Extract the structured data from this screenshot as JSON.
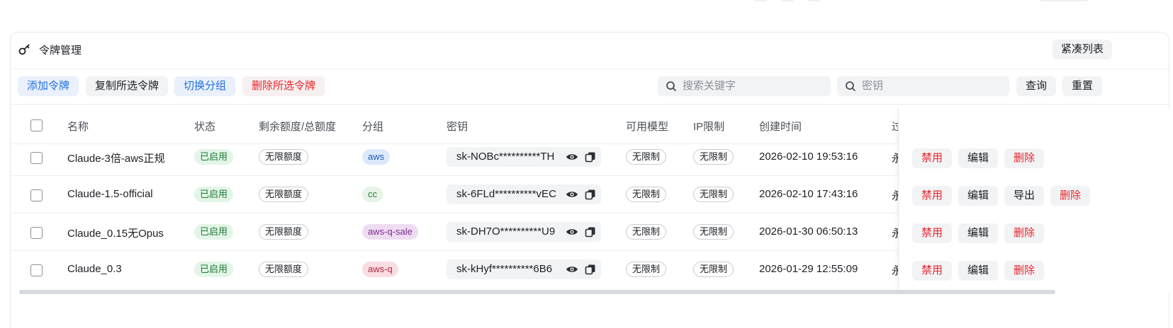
{
  "title": "令牌管理",
  "compact_label": "紧凑列表",
  "toolbar": {
    "add": "添加令牌",
    "copy_selected": "复制所选令牌",
    "switch_group": "切换分组",
    "delete_selected": "删除所选令牌",
    "search_keyword_placeholder": "搜索关键字",
    "search_key_placeholder": "密钥",
    "query": "查询",
    "reset": "重置"
  },
  "columns": [
    "名称",
    "状态",
    "剩余额度/总额度",
    "分组",
    "密钥",
    "可用模型",
    "IP限制",
    "创建时间",
    "过"
  ],
  "rows": [
    {
      "name": "Claude-3倍-aws正规",
      "status": "已启用",
      "quota": "无限额度",
      "group": "aws",
      "key": "sk-NOBc**********TH",
      "models": "无限制",
      "ip": "无限制",
      "created": "2026-02-10 19:53:16",
      "expire": "永",
      "actions": [
        "禁用",
        "编辑",
        "删除"
      ]
    },
    {
      "name": "Claude-1.5-official",
      "status": "已启用",
      "quota": "无限额度",
      "group": "cc",
      "key": "sk-6FLd**********vEC",
      "models": "无限制",
      "ip": "无限制",
      "created": "2026-02-10 17:43:16",
      "expire": "永",
      "actions": [
        "禁用",
        "编辑",
        "导出",
        "删除"
      ]
    },
    {
      "name": "Claude_0.15无Opus",
      "status": "已启用",
      "quota": "无限额度",
      "group": "aws-q-sale",
      "key": "sk-DH7O**********U9",
      "models": "无限制",
      "ip": "无限制",
      "created": "2026-01-30 06:50:13",
      "expire": "永",
      "actions": [
        "禁用",
        "编辑",
        "删除"
      ]
    },
    {
      "name": "Claude_0.3",
      "status": "已启用",
      "quota": "无限额度",
      "group": "aws-q",
      "key": "sk-kHyf**********6B6",
      "models": "无限制",
      "ip": "无限制",
      "created": "2026-01-29 12:55:09",
      "expire": "永",
      "actions": [
        "禁用",
        "编辑",
        "删除"
      ]
    }
  ],
  "colors": {
    "accent_blue": "#1f6fde",
    "danger_red": "#e5262d",
    "enabled_green": "#1d7a36"
  },
  "icons": {
    "title": "key-icon",
    "search": "search-icon",
    "reveal": "eye-icon",
    "copy": "copy-icon"
  }
}
